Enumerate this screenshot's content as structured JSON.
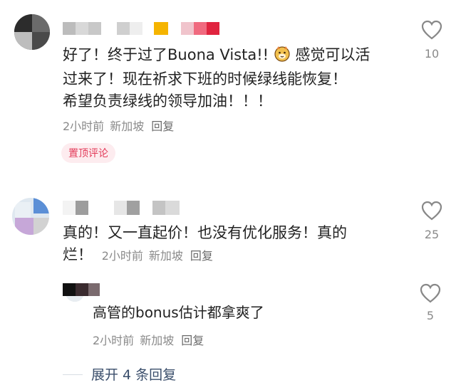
{
  "comments": [
    {
      "text_line1": "好了！终于过了Buona Vista!!",
      "text_after_emoji": "感觉可以活",
      "text_line2": "过来了！现在祈求下班的时候绿线能恢复！",
      "text_line3": "希望负责绿线的领导加油！！！",
      "time": "2小时前",
      "location": "新加坡",
      "reply_label": "回复",
      "badge": "置顶评论",
      "likes": "10",
      "emoji_icon": "smiling-cat-emoji-icon"
    },
    {
      "text_line1": "真的！又一直起价！也没有优化服务！真的",
      "text_line2_start": "烂！",
      "time": "2小时前",
      "location": "新加坡",
      "reply_label": "回复",
      "likes": "25"
    }
  ],
  "reply": {
    "text": "高管的bonus估计都拿爽了",
    "time": "2小时前",
    "location": "新加坡",
    "reply_label": "回复",
    "likes": "5"
  },
  "expand_label": "展开 4 条回复",
  "colors": {
    "accent": "#e33b5a",
    "meta": "#8a8a8a",
    "link": "#3a4e6b"
  }
}
